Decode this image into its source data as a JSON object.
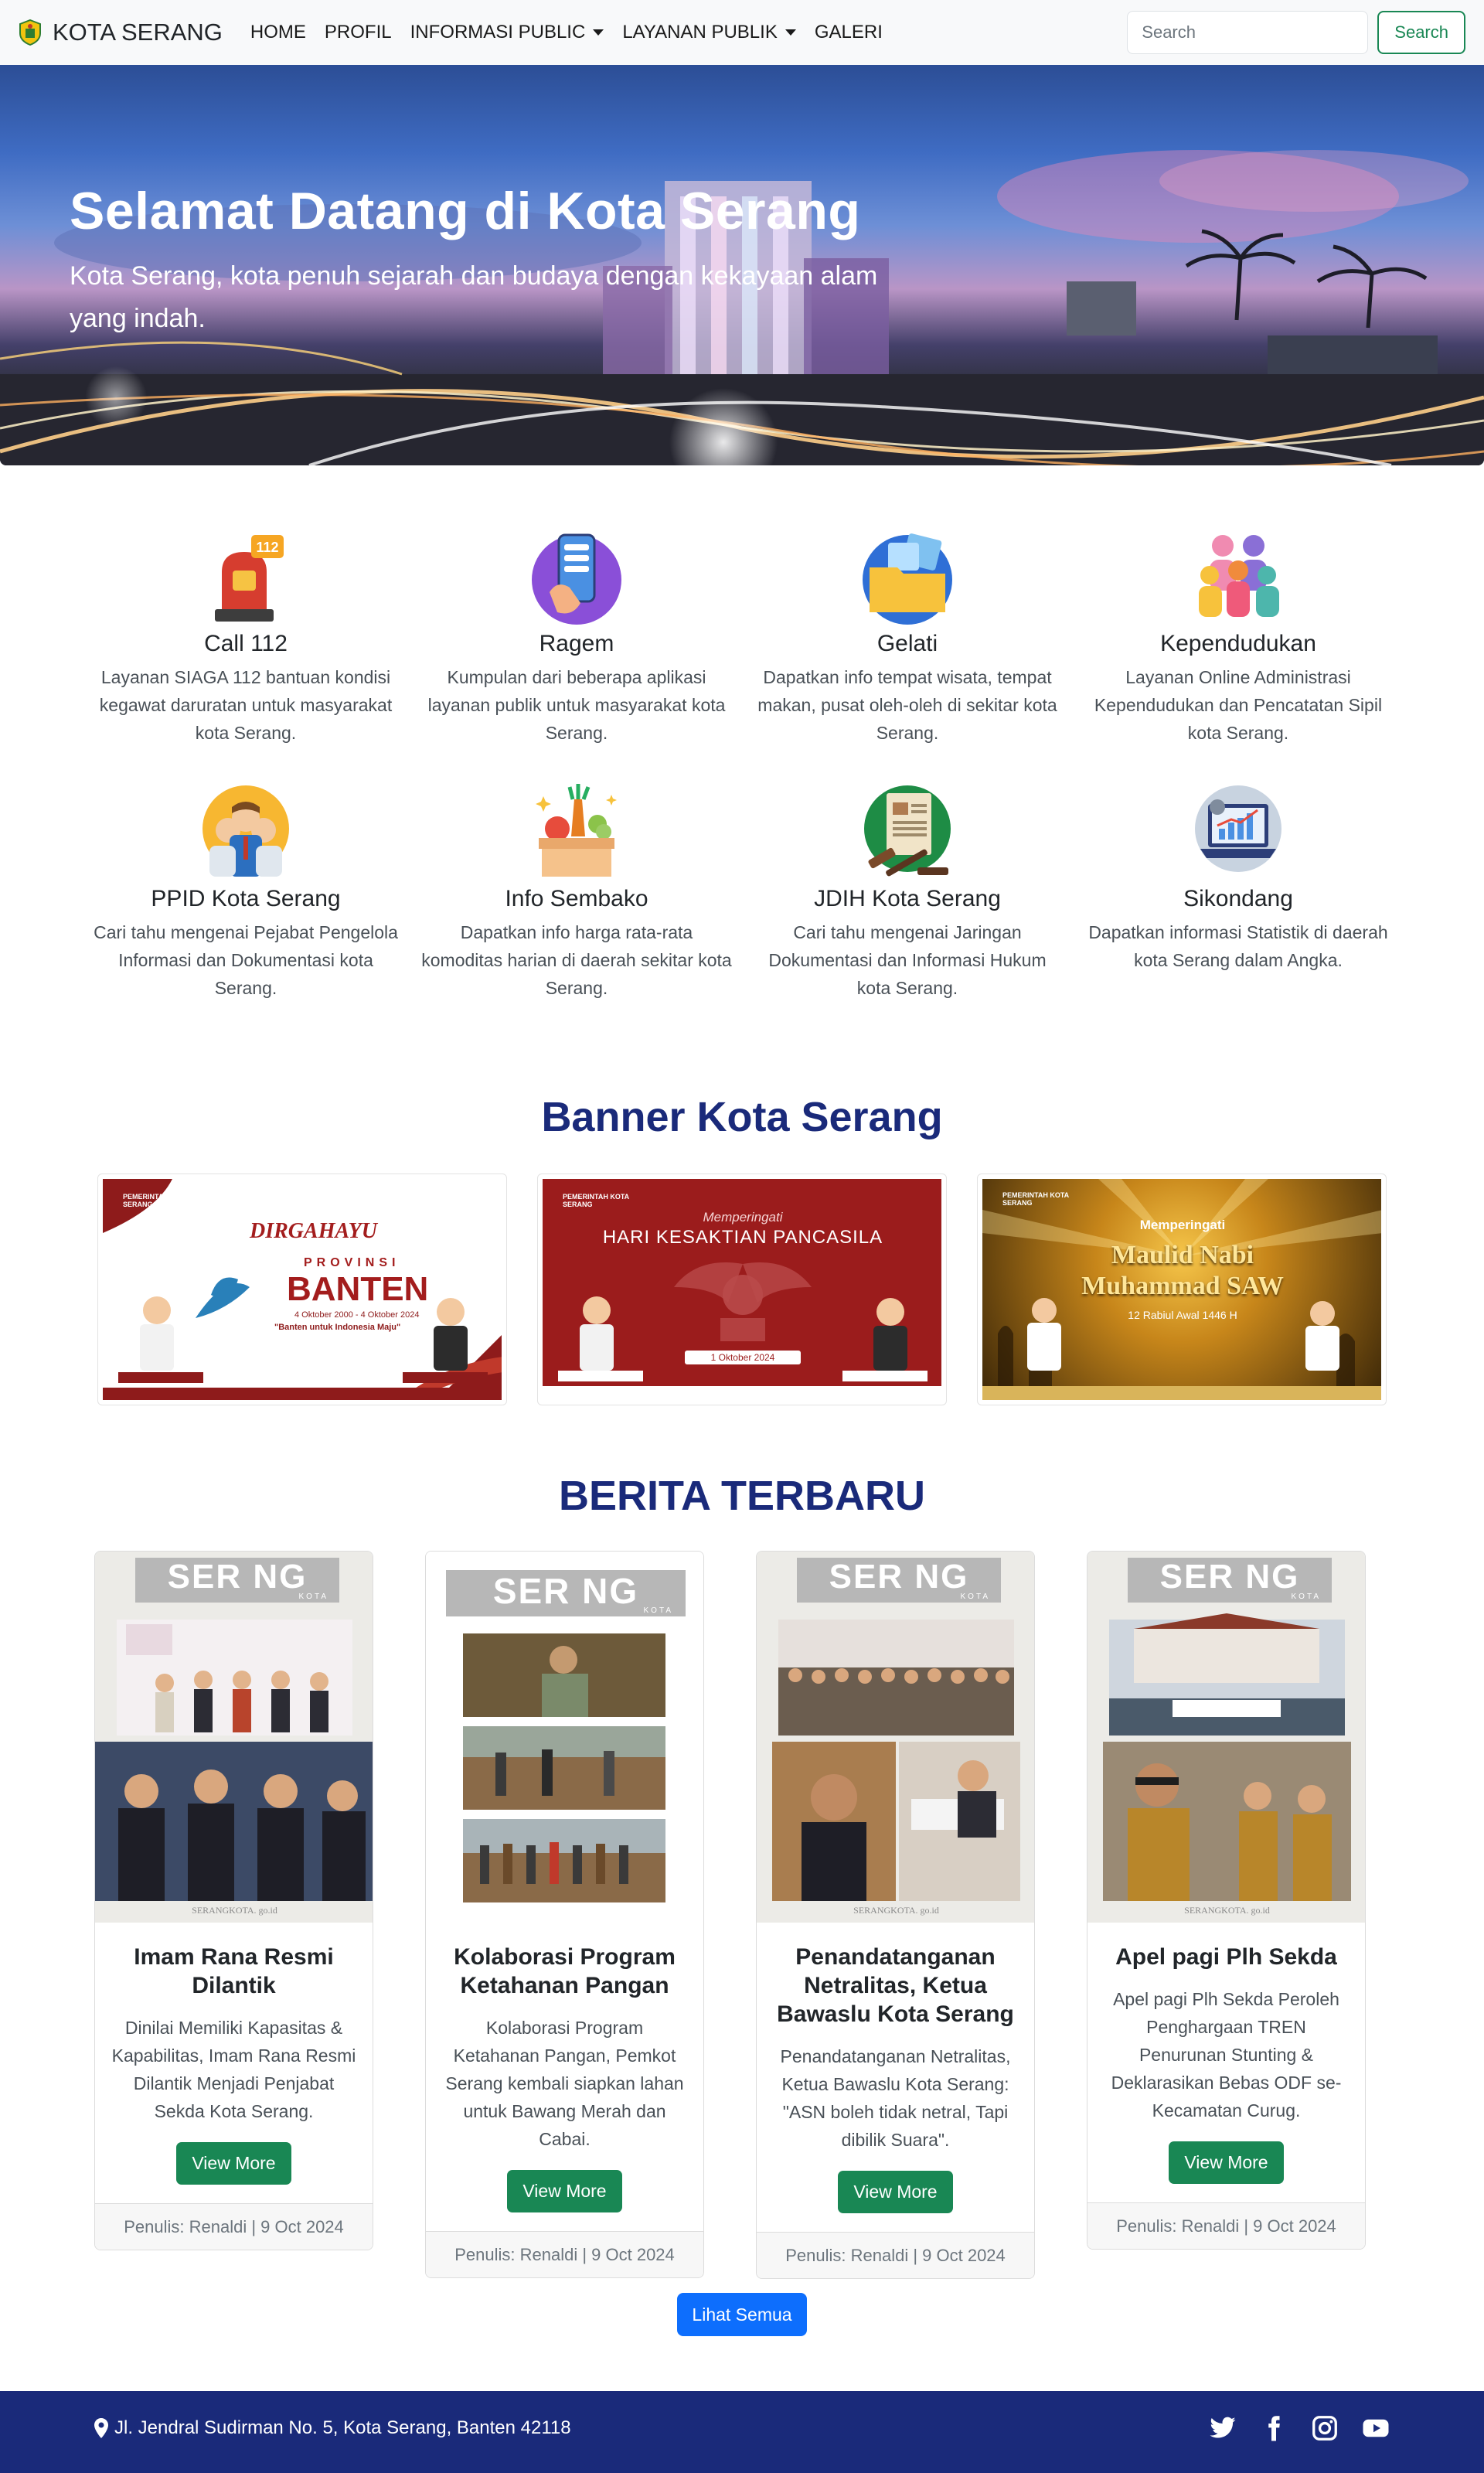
{
  "navbar": {
    "brand": "KOTA SERANG",
    "links": [
      "HOME",
      "PROFIL",
      "INFORMASI PUBLIC",
      "LAYANAN PUBLIK",
      "GALERI"
    ],
    "search_placeholder": "Search",
    "search_button": "Search"
  },
  "hero": {
    "title": "Selamat Datang di Kota Serang",
    "subtitle": "Kota Serang, kota penuh sejarah dan budaya dengan kekayaan alam yang indah."
  },
  "services": [
    {
      "icon": "siren-112-icon",
      "title": "Call 112",
      "desc": "Layanan SIAGA 112 bantuan kondisi kegawat daruratan untuk masyarakat kota Serang."
    },
    {
      "icon": "smartphone-apps-icon",
      "title": "Ragem",
      "desc": "Kumpulan dari beberapa aplikasi layanan publik untuk masyarakat kota Serang."
    },
    {
      "icon": "travel-folder-icon",
      "title": "Gelati",
      "desc": "Dapatkan info tempat wisata, tempat makan, pusat oleh-oleh di sekitar kota Serang."
    },
    {
      "icon": "population-people-icon",
      "title": "Kependudukan",
      "desc": "Layanan Online Administrasi Kependudukan dan Pencatatan Sipil kota Serang."
    },
    {
      "icon": "public-info-officials-icon",
      "title": "PPID Kota Serang",
      "desc": "Cari tahu mengenai Pejabat Pengelola Informasi dan Dokumentasi kota Serang."
    },
    {
      "icon": "grocery-box-icon",
      "title": "Info Sembako",
      "desc": "Dapatkan info harga rata-rata komoditas harian di daerah sekitar kota Serang."
    },
    {
      "icon": "law-gavel-document-icon",
      "title": "JDIH Kota Serang",
      "desc": "Cari tahu mengenai Jaringan Dokumentasi dan Informasi Hukum kota Serang."
    },
    {
      "icon": "statistics-laptop-icon",
      "title": "Sikondang",
      "desc": "Dapatkan informasi Statistik di daerah kota Serang dalam Angka."
    }
  ],
  "banner_section": {
    "heading": "Banner Kota Serang",
    "banners": [
      {
        "org": "PEMERINTAH KOTA SERANG",
        "line1": "DIRGAHAYU",
        "line2": "PROVINSI",
        "line3": "BANTEN",
        "line4": "4 Oktober 2000 - 4 Oktober 2024",
        "line5": "\"Banten untuk Indonesia Maju\""
      },
      {
        "org": "PEMERINTAH KOTA SERANG",
        "line1": "Memperingati",
        "line2": "HARI KESAKTIAN PANCASILA",
        "line3": "1 Oktober 2024"
      },
      {
        "org": "PEMERINTAH KOTA SERANG",
        "line1": "Memperingati",
        "line2": "Maulid Nabi",
        "line3": "Muhammad SAW",
        "line4": "12 Rabiul Awal 1446 H"
      }
    ]
  },
  "news_section": {
    "heading": "BERITA TERBARU",
    "logo_text": "SER NG",
    "logo_sub": "KOTA",
    "site_label": "SERANGKOTA. go.id",
    "view_more": "View More",
    "items": [
      {
        "title": "Imam Rana Resmi Dilantik",
        "desc": "Dinilai Memiliki Kapasitas & Kapabilitas, Imam Rana Resmi Dilantik Menjadi Penjabat Sekda Kota Serang.",
        "footer": "Penulis: Renaldi | 9 Oct 2024"
      },
      {
        "title": "Kolaborasi Program Ketahanan Pangan",
        "desc": "Kolaborasi Program Ketahanan Pangan, Pemkot Serang kembali siapkan lahan untuk Bawang Merah dan Cabai.",
        "footer": "Penulis: Renaldi | 9 Oct 2024"
      },
      {
        "title": "Penandatanganan Netralitas, Ketua Bawaslu Kota Serang",
        "desc": "Penandatanganan Netralitas, Ketua Bawaslu Kota Serang: \"ASN boleh tidak netral, Tapi dibilik Suara\".",
        "footer": "Penulis: Renaldi | 9 Oct 2024"
      },
      {
        "title": "Apel pagi Plh Sekda",
        "desc": "Apel pagi Plh Sekda Peroleh Penghargaan TREN Penurunan Stunting & Deklarasikan Bebas ODF se-Kecamatan Curug.",
        "footer": "Penulis: Renaldi | 9 Oct 2024"
      }
    ],
    "see_all": "Lihat Semua"
  },
  "footer": {
    "address": "Jl. Jendral Sudirman No. 5, Kota Serang, Banten 42118",
    "social": [
      "twitter-icon",
      "facebook-icon",
      "instagram-icon",
      "youtube-icon"
    ]
  },
  "colors": {
    "heading_navy": "#1a2a7a",
    "success_green": "#198754",
    "primary_blue": "#0d6efd",
    "footer_bg": "#1a2a7a"
  }
}
